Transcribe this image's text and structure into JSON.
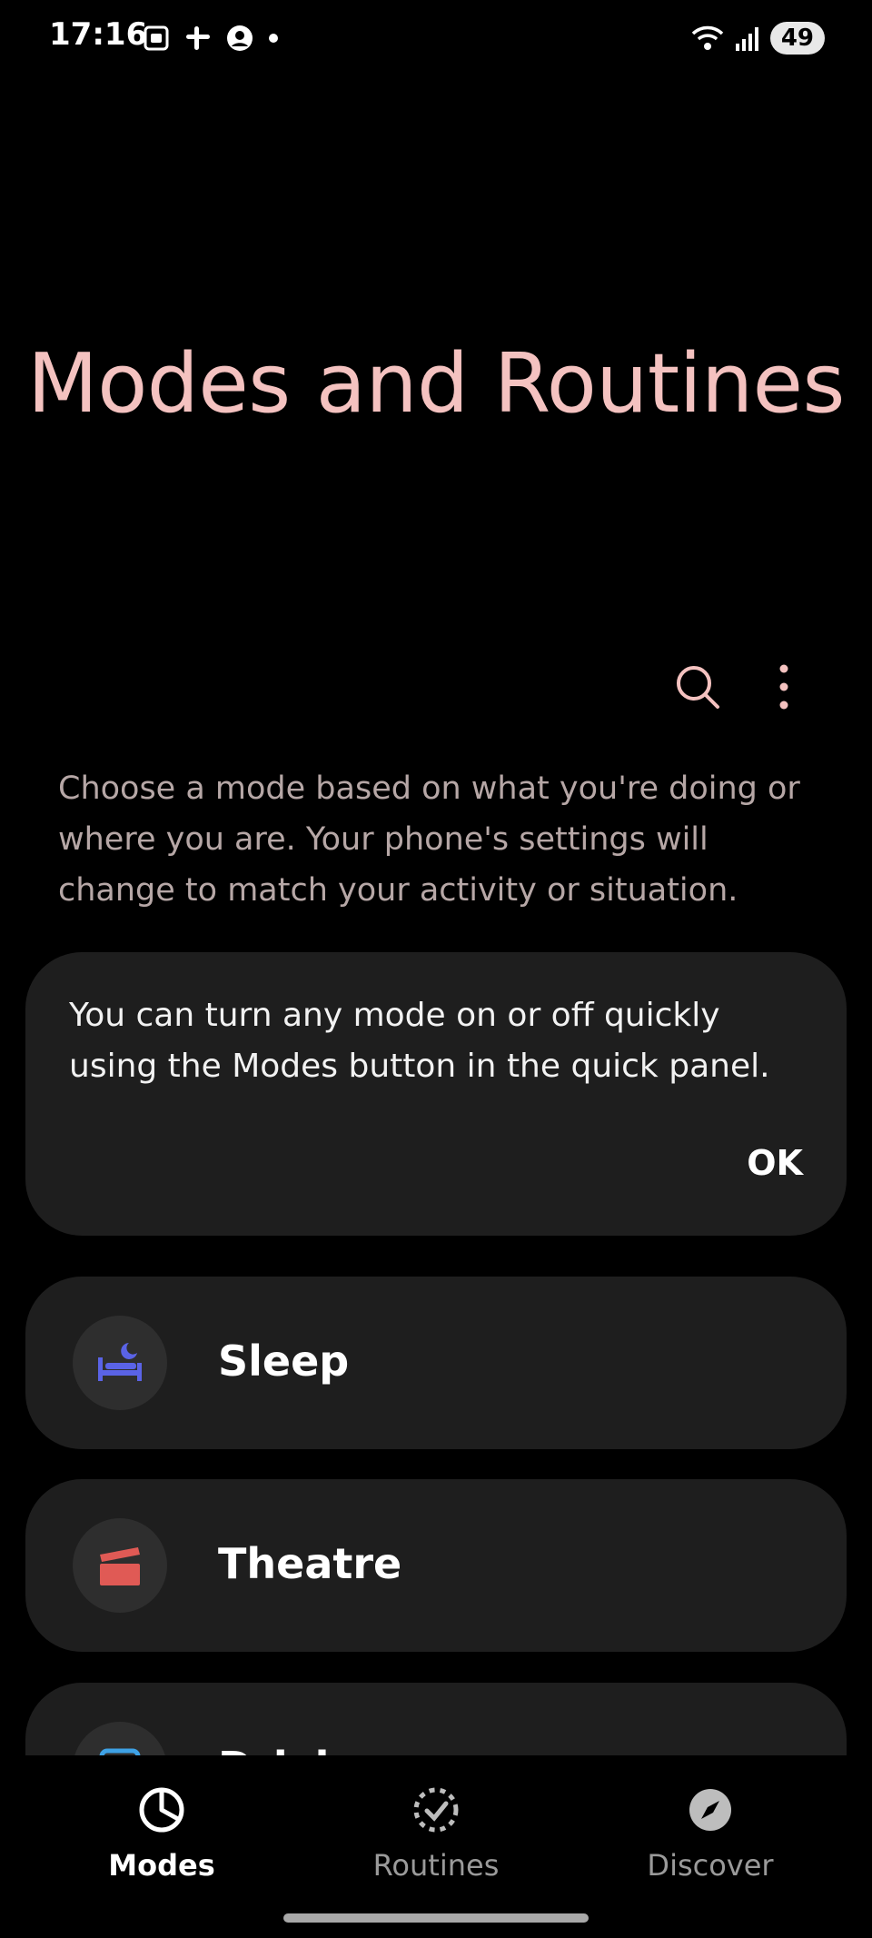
{
  "status_bar": {
    "time": "17:16",
    "battery": "49"
  },
  "page": {
    "title": "Modes and Routines",
    "description": "Choose a mode based on what you're doing or where you are. Your phone's settings will change to match your activity or situation."
  },
  "info_card": {
    "text": "You can turn any mode on or off quickly using the Modes button in the quick panel.",
    "ok_label": "OK"
  },
  "modes": [
    {
      "label": "Sleep",
      "icon": "bed-moon-icon",
      "color": "#5a63e6"
    },
    {
      "label": "Theatre",
      "icon": "clapperboard-icon",
      "color": "#e05a55"
    },
    {
      "label": "Driving",
      "icon": "car-icon",
      "color": "#3ea2e6"
    }
  ],
  "nav": {
    "items": [
      {
        "label": "Modes",
        "icon": "modes-icon",
        "active": true
      },
      {
        "label": "Routines",
        "icon": "routines-icon",
        "active": false
      },
      {
        "label": "Discover",
        "icon": "compass-icon",
        "active": false
      }
    ]
  },
  "colors": {
    "accent": "#f4c2c0",
    "card_bg": "#1e1e1e"
  }
}
